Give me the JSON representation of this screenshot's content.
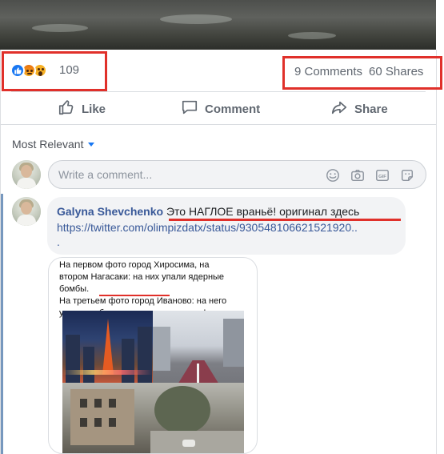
{
  "post": {
    "reactions": {
      "icons": [
        "like-icon",
        "angry-icon",
        "wow-icon"
      ],
      "count": "109"
    },
    "stats": {
      "comments": "9 Comments",
      "shares": "60 Shares"
    },
    "actions": {
      "like": "Like",
      "comment": "Comment",
      "share": "Share"
    }
  },
  "comments": {
    "sort_label": "Most Relevant",
    "input_placeholder": "Write a comment...",
    "input_icons": [
      "emoji-icon",
      "camera-icon",
      "gif-icon",
      "sticker-icon"
    ],
    "items": [
      {
        "author": "Galyna Shevchenko",
        "text": "Это НАГЛОЕ враньё! оригинал здесь",
        "link": "https://twitter.com/olimpizdatx/status/930548106621521920..",
        "link_tail": ".",
        "image_caption": {
          "line1": "На первом фото город Хиросима, на",
          "line2": "втором Нагасаки: на них упали ядерные",
          "line3": "бомбы.",
          "line4": "На третьем фото город Иваново: на него",
          "line5": "упали стабильность и процветание!"
        }
      }
    ]
  },
  "colors": {
    "highlight_red": "#e0302a",
    "link_blue": "#385898",
    "accent_blue": "#1877f2"
  }
}
